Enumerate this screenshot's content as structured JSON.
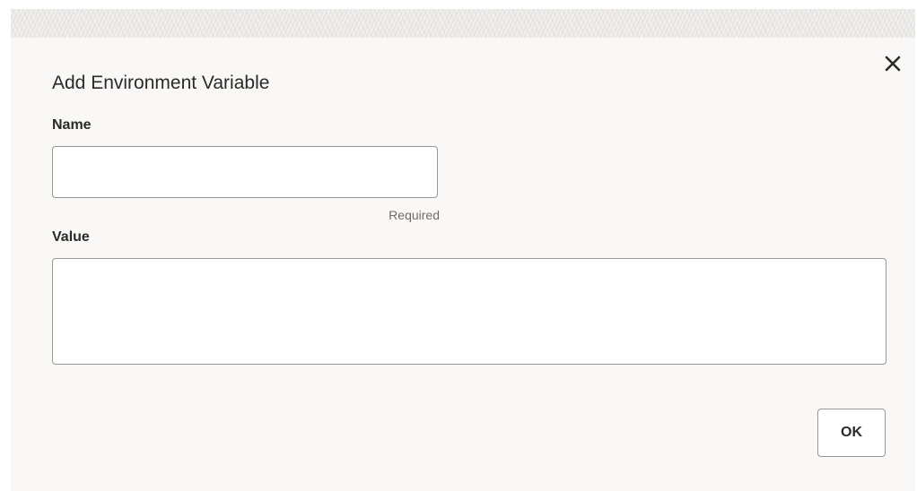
{
  "dialog": {
    "title": "Add Environment Variable",
    "close_icon": "close-icon",
    "fields": {
      "name": {
        "label": "Name",
        "value": "",
        "placeholder": "",
        "hint": "Required"
      },
      "value": {
        "label": "Value",
        "value": "",
        "placeholder": ""
      }
    },
    "ok_label": "OK"
  },
  "colors": {
    "dialog_background": "#f9f8f7",
    "text": "#2b2a28",
    "border": "#9a9793",
    "hint_text": "#6f6c69"
  }
}
